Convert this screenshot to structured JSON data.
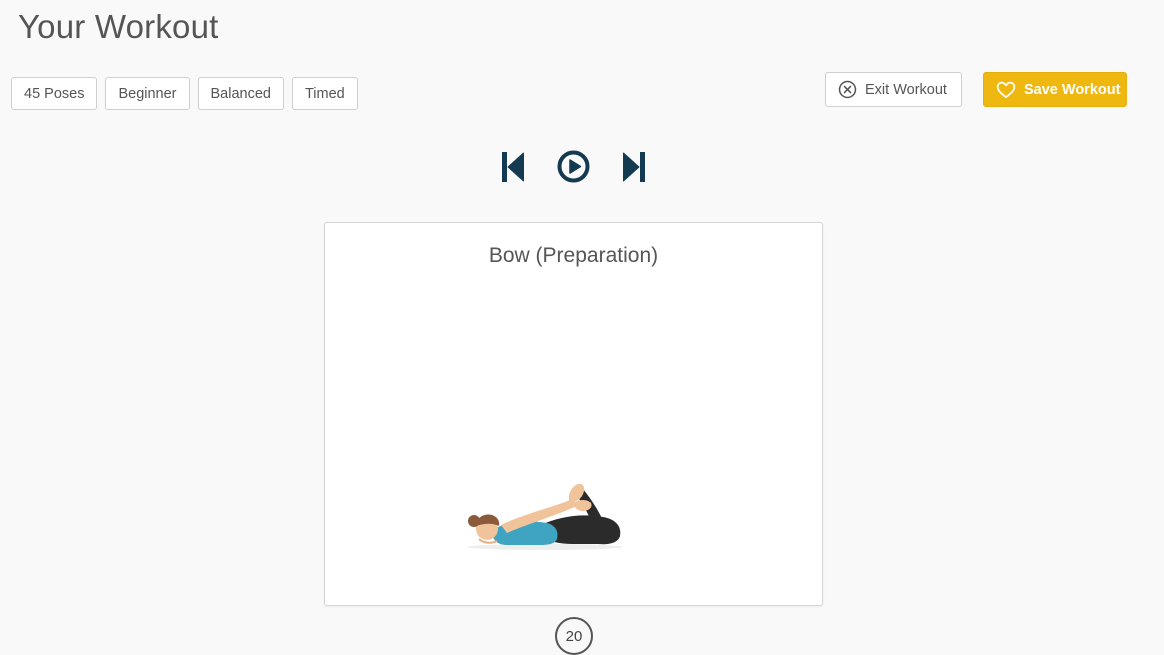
{
  "header": {
    "title": "Your Workout"
  },
  "tags": [
    "45 Poses",
    "Beginner",
    "Balanced",
    "Timed"
  ],
  "actions": {
    "exit_label": "Exit Workout",
    "save_label": "Save Workout"
  },
  "player": {
    "prev_icon": "skip-previous-icon",
    "play_icon": "play-circle-icon",
    "next_icon": "skip-next-icon"
  },
  "pose": {
    "name": "Bow (Preparation)",
    "illustration": "yoga-bow-pose-illustration"
  },
  "timer": {
    "seconds": "20"
  },
  "colors": {
    "accent": "#efb810",
    "icon_dark": "#143a52",
    "text": "#555555"
  }
}
